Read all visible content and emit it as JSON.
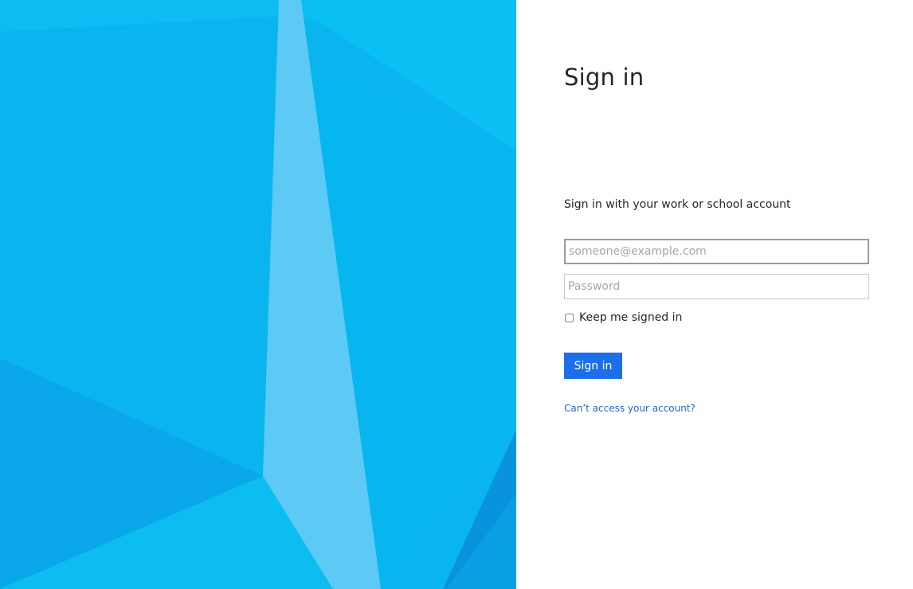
{
  "illustration": {
    "colors": {
      "base": "#0ab4ef",
      "light": "#5ccaf5",
      "mid": "#09bdf2",
      "deep": "#0aa8ec",
      "dark": "#0993dc",
      "pale": "#11c4f6"
    }
  },
  "signin": {
    "title": "Sign in",
    "subtitle": "Sign in with your work or school account",
    "email_placeholder": "someone@example.com",
    "password_placeholder": "Password",
    "keep_signed_in_label": "Keep me signed in",
    "submit_label": "Sign in",
    "help_link": "Can’t access your account?",
    "accent_color": "#1c6fe8",
    "link_color": "#2a62c9"
  }
}
